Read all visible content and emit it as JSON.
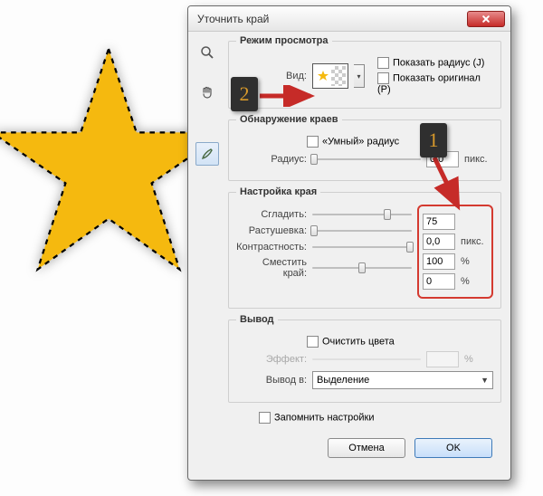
{
  "dialog": {
    "title": "Уточнить край",
    "view_section": {
      "legend": "Режим просмотра",
      "view_label": "Вид:",
      "show_radius": "Показать радиус (J)",
      "show_original": "Показать оригинал (P)"
    },
    "edge_section": {
      "legend": "Обнаружение краев",
      "smart_radius": "«Умный» радиус",
      "radius_label": "Радиус:",
      "radius_value": "0,0",
      "radius_unit": "пикс."
    },
    "adjust_section": {
      "legend": "Настройка края",
      "smooth_label": "Сгладить:",
      "smooth_value": "75",
      "feather_label": "Растушевка:",
      "feather_value": "0,0",
      "feather_unit": "пикс.",
      "contrast_label": "Контрастность:",
      "contrast_value": "100",
      "contrast_unit": "%",
      "shift_label": "Сместить край:",
      "shift_value": "0",
      "shift_unit": "%"
    },
    "output_section": {
      "legend": "Вывод",
      "decontaminate": "Очистить цвета",
      "effect_label": "Эффект:",
      "effect_unit": "%",
      "output_to_label": "Вывод в:",
      "output_to_value": "Выделение"
    },
    "remember": "Запомнить настройки",
    "buttons": {
      "cancel": "Отмена",
      "ok": "OK"
    }
  },
  "annotations": {
    "badge1": "1",
    "badge2": "2"
  },
  "colors": {
    "star": "#f5b90f",
    "highlight_box": "#d43a30"
  }
}
